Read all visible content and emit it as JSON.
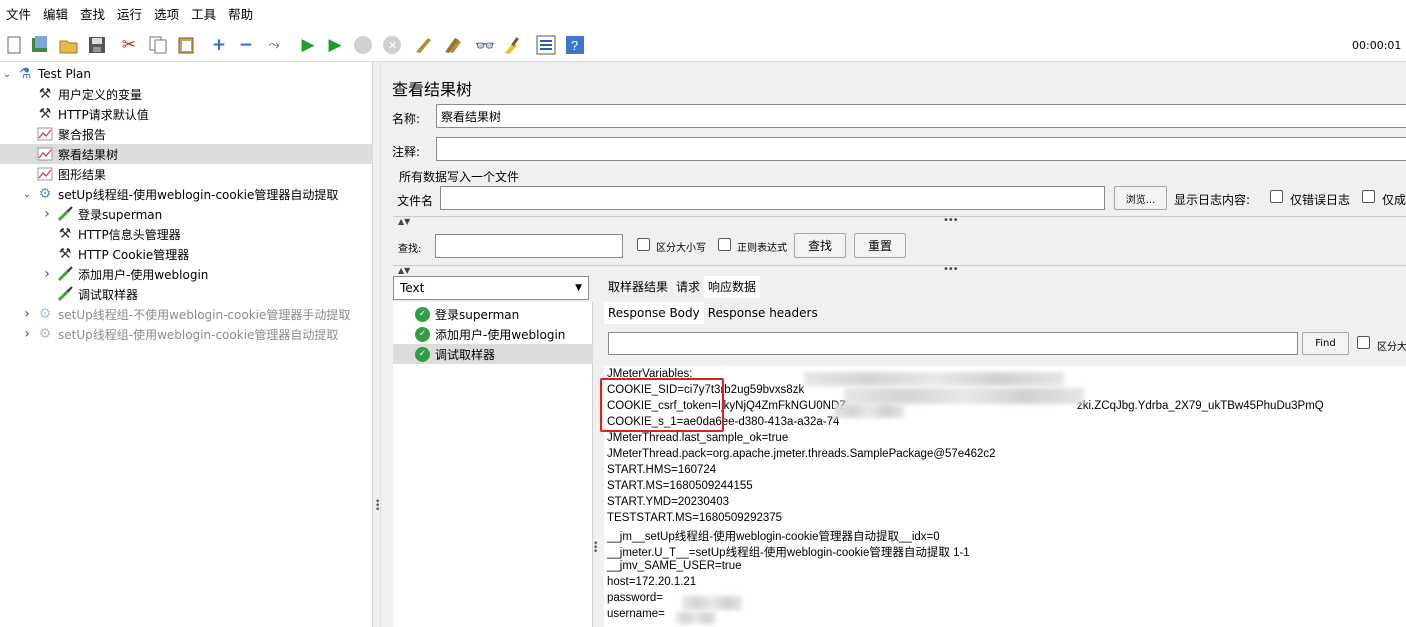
{
  "menu": [
    "文件",
    "编辑",
    "查找",
    "运行",
    "选项",
    "工具",
    "帮助"
  ],
  "toolbar": {
    "timer": "00:00:01",
    "icons": [
      "new-icon",
      "templates-icon",
      "open-icon",
      "save-icon",
      "cut-icon",
      "copy-icon",
      "paste-icon",
      "expand-icon",
      "collapse-icon",
      "toggle-icon",
      "start-icon",
      "start-no-pause-icon",
      "stop-icon",
      "shutdown-icon",
      "clear-icon",
      "clear-all-icon",
      "search-icon",
      "reset-search-icon",
      "function-helper-icon",
      "help-icon"
    ]
  },
  "tree": [
    {
      "label": "Test Plan",
      "icon": "flask-icon",
      "depth": 0,
      "chevron": "down",
      "selected": false,
      "disabled": false
    },
    {
      "label": "用户定义的变量",
      "icon": "tools-icon",
      "depth": 1,
      "chevron": "",
      "selected": false,
      "disabled": false
    },
    {
      "label": "HTTP请求默认值",
      "icon": "tools-icon",
      "depth": 1,
      "chevron": "",
      "selected": false,
      "disabled": false
    },
    {
      "label": "聚合报告",
      "icon": "chart-icon",
      "depth": 1,
      "chevron": "",
      "selected": false,
      "disabled": false
    },
    {
      "label": "察看结果树",
      "icon": "chart-icon",
      "depth": 1,
      "chevron": "",
      "selected": true,
      "disabled": false
    },
    {
      "label": "图形结果",
      "icon": "chart-icon",
      "depth": 1,
      "chevron": "",
      "selected": false,
      "disabled": false
    },
    {
      "label": "setUp线程组-使用weblogin-cookie管理器自动提取",
      "icon": "gear-icon",
      "depth": 1,
      "chevron": "down",
      "selected": false,
      "disabled": false
    },
    {
      "label": "登录superman",
      "icon": "pipette-icon",
      "depth": 2,
      "chevron": "right",
      "selected": false,
      "disabled": false
    },
    {
      "label": "HTTP信息头管理器",
      "icon": "tools-icon",
      "depth": 2,
      "chevron": "",
      "selected": false,
      "disabled": false
    },
    {
      "label": "HTTP Cookie管理器",
      "icon": "tools-icon",
      "depth": 2,
      "chevron": "",
      "selected": false,
      "disabled": false
    },
    {
      "label": "添加用户-使用weblogin",
      "icon": "pipette-icon",
      "depth": 2,
      "chevron": "right",
      "selected": false,
      "disabled": false
    },
    {
      "label": "调试取样器",
      "icon": "pipette-icon",
      "depth": 2,
      "chevron": "",
      "selected": false,
      "disabled": false
    },
    {
      "label": "setUp线程组-不使用weblogin-cookie管理器手动提取",
      "icon": "gear-icon",
      "depth": 1,
      "chevron": "right",
      "selected": false,
      "disabled": true
    },
    {
      "label": "setUp线程组-使用weblogin-cookie管理器自动提取",
      "icon": "gear-icon",
      "depth": 1,
      "chevron": "right",
      "selected": false,
      "disabled": true
    }
  ],
  "panel": {
    "title": "查看结果树",
    "name_label": "名称:",
    "name_value": "察看结果树",
    "comment_label": "注释:",
    "comment_value": "",
    "file_section_label": "所有数据写入一个文件",
    "filename_label": "文件名",
    "filename_value": "",
    "browse_button": "浏览...",
    "log_label": "显示日志内容:",
    "errors_only_label": "仅错误日志",
    "success_only_label": "仅成"
  },
  "search": {
    "label": "查找:",
    "value": "",
    "case_sensitive_label": "区分大小写",
    "regex_label": "正则表达式",
    "find_button": "查找",
    "reset_button": "重置"
  },
  "results": {
    "renderer": "Text",
    "items": [
      {
        "label": "登录superman",
        "selected": false
      },
      {
        "label": "添加用户-使用weblogin",
        "selected": false
      },
      {
        "label": "调试取样器",
        "selected": true
      }
    ],
    "tabs": [
      "取样器结果",
      "请求",
      "响应数据"
    ],
    "active_tab": 2,
    "subtabs": [
      "Response Body",
      "Response headers"
    ],
    "active_subtab": 0,
    "find_button": "Find",
    "find_case_label": "区分大",
    "find_value": "",
    "lines": [
      "JMeterVariables:",
      "COOKIE_SID=ci7y7t3rb2ug59bvxs8zk",
      "COOKIE_csrf_token=IjkyNjQ4ZmFkNGU0NDZ",
      "COOKIE_s_1=ae0da6ee-d380-413a-a32a-74",
      "JMeterThread.last_sample_ok=true",
      "JMeterThread.pack=org.apache.jmeter.threads.SamplePackage@57e462c2",
      "START.HMS=160724",
      "START.MS=1680509244155",
      "START.YMD=20230403",
      "TESTSTART.MS=1680509292375",
      "__jm__setUp线程组-使用weblogin-cookie管理器自动提取__idx=0",
      "__jmeter.U_T__=setUp线程组-使用weblogin-cookie管理器自动提取 1-1",
      "__jmv_SAME_USER=true",
      "host=172.20.1.21",
      "password=",
      "username="
    ],
    "csrf_tail": "zki.ZCqJbg.Ydrba_2X79_ukTBw45PhuDu3PmQ",
    "sid_tail": "r0g6f...",
    "highlight_color": "#e02020"
  }
}
